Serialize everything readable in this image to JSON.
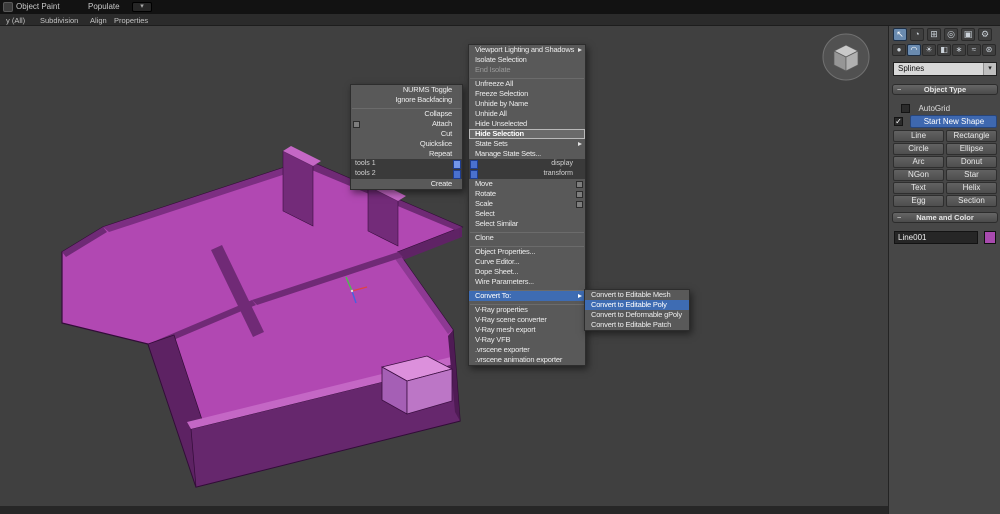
{
  "colors": {
    "menu_highlight": "#3e6cb3",
    "quad_square_blue": "#4a71cf",
    "model_top": "#b148b2",
    "model_wall_dark": "#5f2365",
    "start_new_shape_blue": "#3e68b0",
    "name_color_swatch": "#a84aae",
    "viewport_bg": "#404040"
  },
  "ribbon": {
    "tabs": [
      "Object Paint",
      "Populate"
    ],
    "collapse_icon": "▾",
    "panel_labels": [
      "y (All)",
      "Subdivision",
      "Align",
      "Properties"
    ]
  },
  "quad_menu": {
    "left": {
      "items": [
        "NURMS Toggle",
        "Ignore Backfacing",
        "Collapse",
        "Attach",
        "Cut",
        "Quickslice",
        "Repeat"
      ],
      "headers": [
        "tools 1",
        "tools 2"
      ],
      "create": "Create"
    },
    "right_upper": [
      "Viewport Lighting and Shadows",
      "Isolate Selection",
      "End Isolate",
      "Unfreeze All",
      "Freeze Selection",
      "Unhide by Name",
      "Unhide All",
      "Hide Unselected",
      "Hide Selection",
      "State Sets",
      "Manage State Sets..."
    ],
    "right_headers": [
      "display",
      "transform"
    ],
    "right_lower": [
      "Move",
      "Rotate",
      "Scale",
      "Select",
      "Select Similar",
      "Clone",
      "Object Properties...",
      "Curve Editor...",
      "Dope Sheet...",
      "Wire Parameters...",
      "Convert To:",
      "V-Ray properties",
      "V-Ray scene converter",
      "V-Ray mesh export",
      "V-Ray VFB",
      ".vrscene exporter",
      ".vrscene animation exporter"
    ],
    "submenu": [
      "Convert to Editable Mesh",
      "Convert to Editable Poly",
      "Convert to Deformable gPoly",
      "Convert to Editable Patch"
    ],
    "highlighted_item": "Convert To:",
    "highlighted_submenu_item": "Convert to Editable Poly",
    "emphasized_item": "Hide Selection"
  },
  "command_panel": {
    "tabs": [
      {
        "name": "create",
        "glyph": "↖"
      },
      {
        "name": "modify",
        "glyph": "◔"
      },
      {
        "name": "hierarchy",
        "glyph": "⊞"
      },
      {
        "name": "motion",
        "glyph": "◎"
      },
      {
        "name": "display",
        "glyph": "▣"
      },
      {
        "name": "utilities",
        "glyph": "⚙"
      }
    ],
    "categories": [
      {
        "name": "geometry",
        "glyph": "●"
      },
      {
        "name": "shapes",
        "glyph": "◠"
      },
      {
        "name": "lights",
        "glyph": "☀"
      },
      {
        "name": "cameras",
        "glyph": "◧"
      },
      {
        "name": "helpers",
        "glyph": "∗"
      },
      {
        "name": "space-warps",
        "glyph": "≈"
      },
      {
        "name": "systems",
        "glyph": "⊛"
      }
    ],
    "subcategory_dropdown": {
      "value": "Splines",
      "arrow": "▾"
    },
    "object_type": {
      "title": "Object Type",
      "collapse": "−",
      "autogrid": "AutoGrid",
      "check": "✓",
      "start_new_shape": "Start New Shape",
      "buttons": [
        "Line",
        "Rectangle",
        "Circle",
        "Ellipse",
        "Arc",
        "Donut",
        "NGon",
        "Star",
        "Text",
        "Helix",
        "Egg",
        "Section"
      ]
    },
    "name_color": {
      "title": "Name and Color",
      "collapse": "−",
      "name_value": "Line001"
    }
  }
}
